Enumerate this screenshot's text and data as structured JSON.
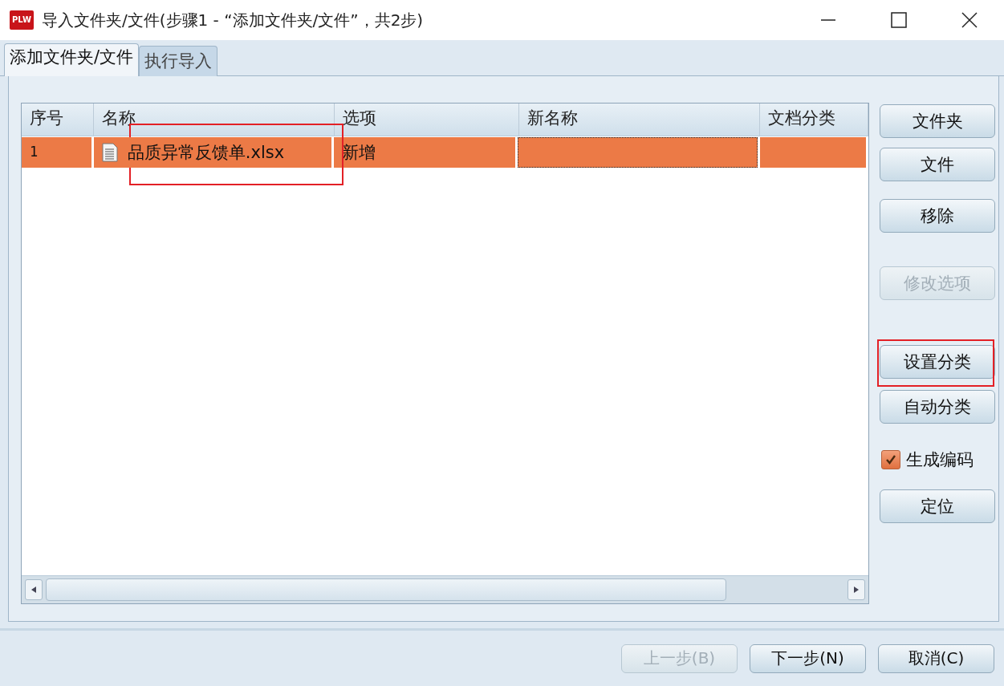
{
  "window": {
    "title": "导入文件夹/文件(步骤1 - “添加文件夹/文件”，共2步)",
    "app_badge": "PLW"
  },
  "tabs": [
    {
      "label": "添加文件夹/文件",
      "selected": true
    },
    {
      "label": "执行导入",
      "selected": false
    }
  ],
  "table": {
    "columns": [
      "序号",
      "名称",
      "选项",
      "新名称",
      "文档分类"
    ],
    "rows": [
      {
        "selected": true,
        "cells": [
          "1",
          "品质异常反馈单.xlsx",
          "新增",
          "",
          ""
        ],
        "highlighted": true
      }
    ]
  },
  "side_controls": [
    {
      "kind": "button",
      "label": "文件夹",
      "disabled": false,
      "highlighted": false
    },
    {
      "kind": "button",
      "label": "文件",
      "disabled": false,
      "highlighted": false
    },
    {
      "kind": "button",
      "label": "移除",
      "disabled": false,
      "highlighted": false
    },
    {
      "kind": "button",
      "label": "修改选项",
      "disabled": true,
      "highlighted": false
    },
    {
      "kind": "button",
      "label": "设置分类",
      "disabled": false,
      "highlighted": true
    },
    {
      "kind": "button",
      "label": "自动分类",
      "disabled": false,
      "highlighted": false
    },
    {
      "kind": "checkbox",
      "label": "生成编码",
      "checked": true
    },
    {
      "kind": "button",
      "label": "定位",
      "disabled": false,
      "highlighted": false
    }
  ],
  "footer_buttons": [
    {
      "label": "上一步(B)",
      "disabled": true
    },
    {
      "label": "下一步(N)",
      "disabled": false
    },
    {
      "label": "取消(C)",
      "disabled": false
    }
  ]
}
